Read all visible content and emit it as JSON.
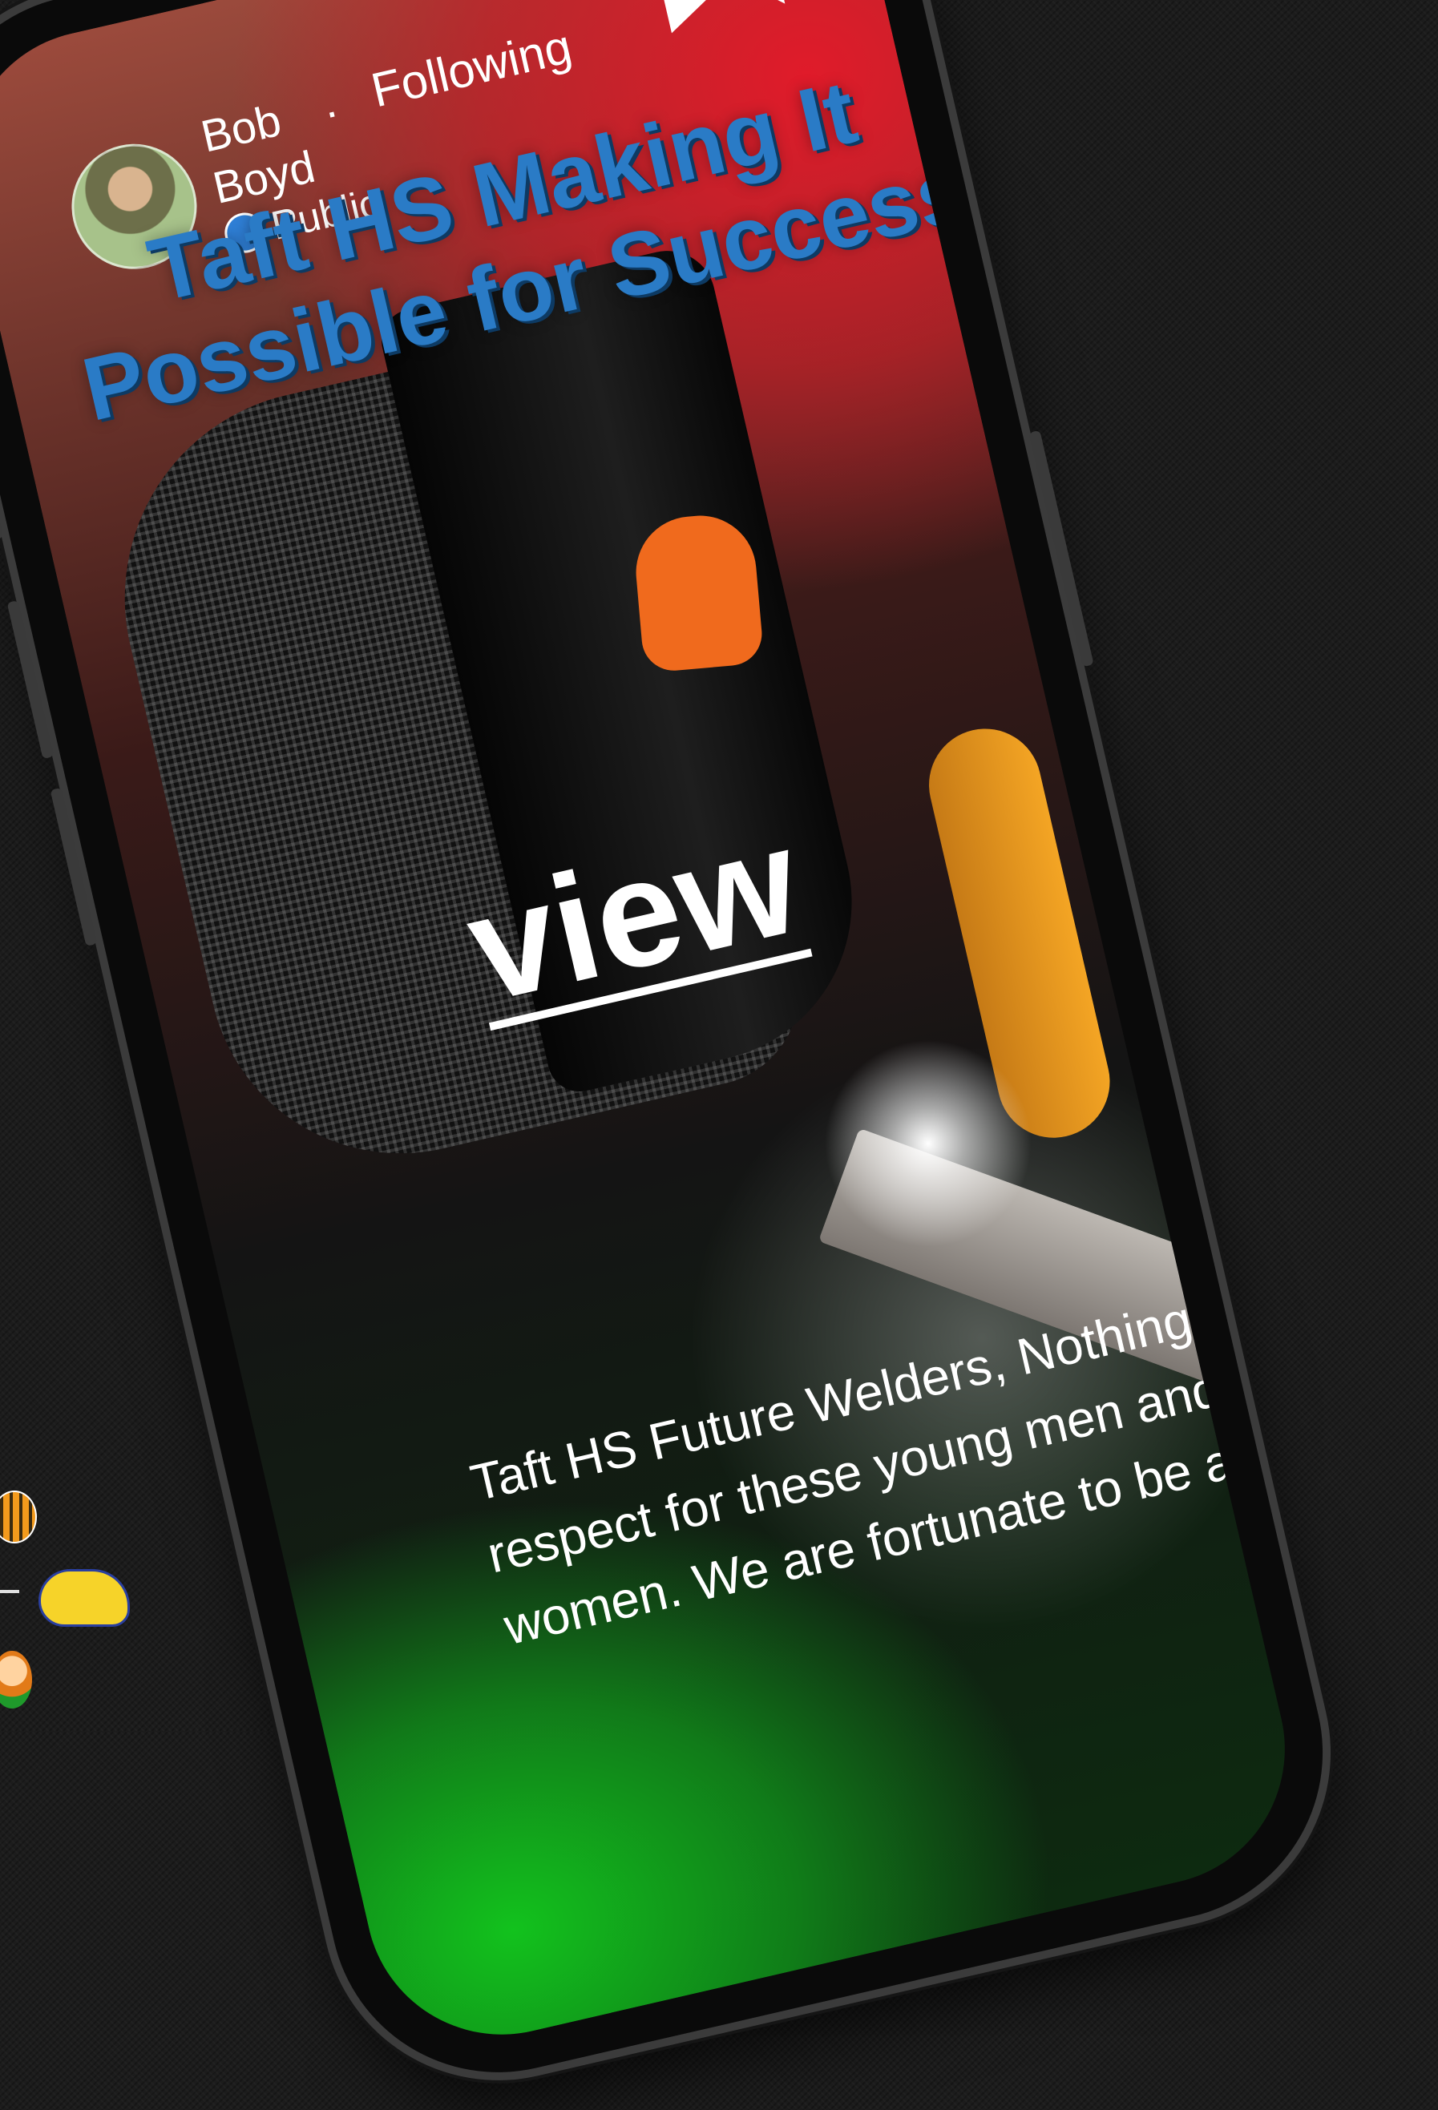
{
  "post": {
    "author_name": "Bob Boyd",
    "follow_label": "Following",
    "privacy": "Public",
    "headline": "Taft HS Making It Possible for Success",
    "view_label": "view",
    "caption": "Taft HS Future Welders, Nothing but respect for these young men and women. We are fortunate to be a part"
  },
  "colors": {
    "headline": "#2a7bc6",
    "gradient_top": "#e01b2a",
    "gradient_bottom": "#12c21d"
  }
}
